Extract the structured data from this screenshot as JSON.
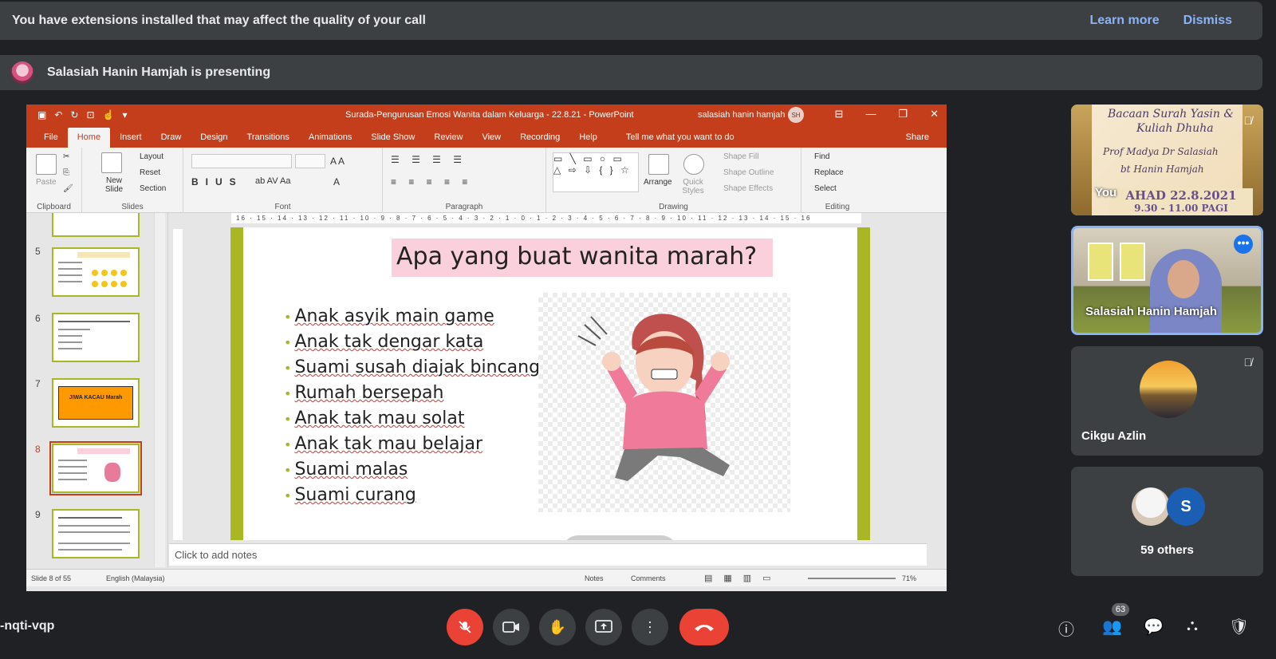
{
  "banner": {
    "extensions_message": "You have extensions installed that may affect the quality of your call",
    "learn_more": "Learn more",
    "dismiss": "Dismiss"
  },
  "presenting_banner": {
    "message": "Salasiah Hanin Hamjah is presenting"
  },
  "powerpoint": {
    "doc_title": "Surada-Pengurusan Emosi Wanita dalam Keluarga - 22.8.21 - PowerPoint",
    "user_name": "salasiah hanin hamjah",
    "user_initials": "SH",
    "tabs": [
      "File",
      "Home",
      "Insert",
      "Draw",
      "Design",
      "Transitions",
      "Animations",
      "Slide Show",
      "Review",
      "View",
      "Recording",
      "Help"
    ],
    "tell_me": "Tell me what you want to do",
    "share": "Share",
    "ribbon": {
      "paste": "Paste",
      "new_slide": "New Slide",
      "layout": "Layout",
      "reset": "Reset",
      "section": "Section",
      "arrange": "Arrange",
      "quick_styles": "Quick Styles",
      "shape_fill": "Shape Fill",
      "shape_outline": "Shape Outline",
      "shape_effects": "Shape Effects",
      "find": "Find",
      "replace": "Replace",
      "select": "Select",
      "groups": [
        "Clipboard",
        "Slides",
        "Font",
        "Paragraph",
        "Drawing",
        "Editing"
      ]
    },
    "thumbnails": [
      {
        "num": "5"
      },
      {
        "num": "6"
      },
      {
        "num": "7",
        "text": "JIWA KACAU Marah"
      },
      {
        "num": "8"
      },
      {
        "num": "9"
      }
    ],
    "ruler": "16 · 15 · 14 · 13 · 12 · 11 · 10 · 9 · 8 · 7 · 6 · 5 · 4 · 3 · 2 · 1 · 0 · 1 · 2 · 3 · 4 · 5 · 6 · 7 · 8 · 9 · 10 · 11 · 12 · 13 · 14 · 15 · 16",
    "slide": {
      "title": "Apa yang buat wanita marah?",
      "bullets": [
        "Anak asyik main game",
        "Anak tak dengar kata",
        "Suami susah diajak bincang",
        "Rumah bersepah",
        "Anak tak mau solat",
        "Anak tak mau belajar",
        "Suami malas",
        "Suami curang"
      ]
    },
    "notes_placeholder": "Click to add notes",
    "status": {
      "slide_info": "Slide 8 of 55",
      "language": "English (Malaysia)",
      "notes": "Notes",
      "comments": "Comments",
      "zoom": "71%"
    }
  },
  "participants": {
    "tile1": {
      "line1": "Bacaan Surah Yasin &",
      "line2": "Kuliah Dhuha",
      "line3": "Prof Madya Dr Salasiah",
      "line4": "bt Hanin Hamjah",
      "you": "You",
      "date": "AHAD 22.8.2021",
      "time": "9.30 - 11.00 PAGI"
    },
    "tile2_name": "Salasiah Hanin Hamjah",
    "tile3_name": "Cikgu Azlin",
    "tile4": {
      "avatar_letter": "S",
      "others": "59 others"
    }
  },
  "bottom_bar": {
    "meeting_code": "-nqti-vqp",
    "people_count": "63"
  }
}
